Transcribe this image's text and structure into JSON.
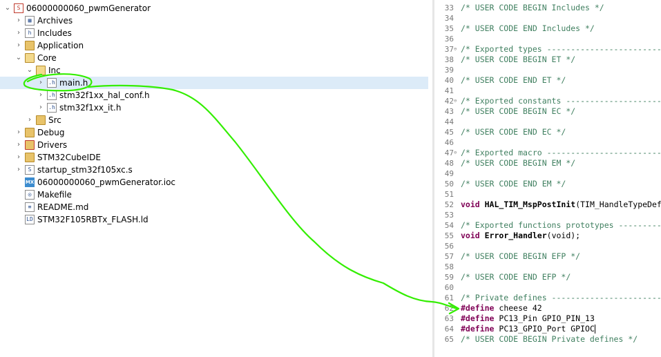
{
  "tree": [
    {
      "label": "06000000060_pwmGenerator",
      "level": 0,
      "arrow": "open",
      "icon": "project-icon"
    },
    {
      "label": "Archives",
      "level": 1,
      "arrow": "closed",
      "icon": "archive-icon"
    },
    {
      "label": "Includes",
      "level": 1,
      "arrow": "closed",
      "icon": "includes-icon"
    },
    {
      "label": "Application",
      "level": 1,
      "arrow": "closed",
      "icon": "folder-icon"
    },
    {
      "label": "Core",
      "level": 1,
      "arrow": "open",
      "icon": "folder-open-icon"
    },
    {
      "label": "Inc",
      "level": 2,
      "arrow": "open",
      "icon": "folder-open-icon"
    },
    {
      "label": "main.h",
      "level": 3,
      "arrow": "closed",
      "icon": "header-file-icon",
      "selected": true
    },
    {
      "label": "stm32f1xx_hal_conf.h",
      "level": 3,
      "arrow": "closed",
      "icon": "header-file-icon"
    },
    {
      "label": "stm32f1xx_it.h",
      "level": 3,
      "arrow": "closed",
      "icon": "header-file-icon"
    },
    {
      "label": "Src",
      "level": 2,
      "arrow": "closed",
      "icon": "folder-icon"
    },
    {
      "label": "Debug",
      "level": 1,
      "arrow": "closed",
      "icon": "folder-icon"
    },
    {
      "label": "Drivers",
      "level": 1,
      "arrow": "closed",
      "icon": "folder-error-icon"
    },
    {
      "label": "STM32CubeIDE",
      "level": 1,
      "arrow": "closed",
      "icon": "folder-icon"
    },
    {
      "label": "startup_stm32f105xc.s",
      "level": 1,
      "arrow": "closed",
      "icon": "asm-file-icon"
    },
    {
      "label": "06000000060_pwmGenerator.ioc",
      "level": 1,
      "arrow": "none",
      "icon": "mx-file-icon"
    },
    {
      "label": "Makefile",
      "level": 1,
      "arrow": "none",
      "icon": "makefile-icon"
    },
    {
      "label": "README.md",
      "level": 1,
      "arrow": "none",
      "icon": "text-file-icon"
    },
    {
      "label": "STM32F105RBTx_FLASH.ld",
      "level": 1,
      "arrow": "none",
      "icon": "linker-file-icon"
    }
  ],
  "editor": {
    "lines": [
      {
        "n": "33",
        "fold": "",
        "parts": [
          {
            "t": "/* USER CODE BEGIN Includes */",
            "c": "cm"
          }
        ]
      },
      {
        "n": "34",
        "fold": "",
        "parts": []
      },
      {
        "n": "35",
        "fold": "",
        "parts": [
          {
            "t": "/* USER CODE END Includes */",
            "c": "cm"
          }
        ]
      },
      {
        "n": "36",
        "fold": "",
        "parts": []
      },
      {
        "n": "37",
        "fold": "⊖",
        "parts": [
          {
            "t": "/* Exported types ------------------------------------------------------------*/",
            "c": "cm"
          }
        ]
      },
      {
        "n": "38",
        "fold": "",
        "parts": [
          {
            "t": "/* USER CODE BEGIN ET */",
            "c": "cm"
          }
        ]
      },
      {
        "n": "39",
        "fold": "",
        "parts": []
      },
      {
        "n": "40",
        "fold": "",
        "parts": [
          {
            "t": "/* USER CODE END ET */",
            "c": "cm"
          }
        ]
      },
      {
        "n": "41",
        "fold": "",
        "parts": []
      },
      {
        "n": "42",
        "fold": "⊖",
        "parts": [
          {
            "t": "/* Exported constants --------------------------------------------------------*/",
            "c": "cm"
          }
        ]
      },
      {
        "n": "43",
        "fold": "",
        "parts": [
          {
            "t": "/* USER CODE BEGIN EC */",
            "c": "cm"
          }
        ]
      },
      {
        "n": "44",
        "fold": "",
        "parts": []
      },
      {
        "n": "45",
        "fold": "",
        "parts": [
          {
            "t": "/* USER CODE END EC */",
            "c": "cm"
          }
        ]
      },
      {
        "n": "46",
        "fold": "",
        "parts": []
      },
      {
        "n": "47",
        "fold": "⊖",
        "parts": [
          {
            "t": "/* Exported macro ------------------------------------------------------------*/",
            "c": "cm"
          }
        ]
      },
      {
        "n": "48",
        "fold": "",
        "parts": [
          {
            "t": "/* USER CODE BEGIN EM */",
            "c": "cm"
          }
        ]
      },
      {
        "n": "49",
        "fold": "",
        "parts": []
      },
      {
        "n": "50",
        "fold": "",
        "parts": [
          {
            "t": "/* USER CODE END EM */",
            "c": "cm"
          }
        ]
      },
      {
        "n": "51",
        "fold": "",
        "parts": []
      },
      {
        "n": "52",
        "fold": "",
        "parts": [
          {
            "t": "void ",
            "c": "kw"
          },
          {
            "t": "HAL_TIM_MspPostInit",
            "c": "fn"
          },
          {
            "t": "(TIM_HandleTypeDef *htim);",
            "c": ""
          }
        ]
      },
      {
        "n": "53",
        "fold": "",
        "parts": []
      },
      {
        "n": "54",
        "fold": "",
        "parts": [
          {
            "t": "/* Exported functions prototypes ---------------------------------------------*/",
            "c": "cm"
          }
        ]
      },
      {
        "n": "55",
        "fold": "",
        "parts": [
          {
            "t": "void ",
            "c": "kw"
          },
          {
            "t": "Error_Handler",
            "c": "fn"
          },
          {
            "t": "(void);",
            "c": ""
          }
        ]
      },
      {
        "n": "56",
        "fold": "",
        "parts": []
      },
      {
        "n": "57",
        "fold": "",
        "parts": [
          {
            "t": "/* USER CODE BEGIN EFP */",
            "c": "cm"
          }
        ]
      },
      {
        "n": "58",
        "fold": "",
        "parts": []
      },
      {
        "n": "59",
        "fold": "",
        "parts": [
          {
            "t": "/* USER CODE END EFP */",
            "c": "cm"
          }
        ]
      },
      {
        "n": "60",
        "fold": "",
        "parts": []
      },
      {
        "n": "61",
        "fold": "",
        "parts": [
          {
            "t": "/* Private defines -----------------------------------------------------------*/",
            "c": "cm"
          }
        ]
      },
      {
        "n": "62",
        "fold": "",
        "parts": [
          {
            "t": "#define",
            "c": "pp"
          },
          {
            "t": " cheese 42",
            "c": ""
          }
        ]
      },
      {
        "n": "63",
        "fold": "",
        "parts": [
          {
            "t": "#define",
            "c": "pp"
          },
          {
            "t": " PC13_Pin GPIO_PIN_13",
            "c": ""
          }
        ]
      },
      {
        "n": "64",
        "fold": "",
        "parts": [
          {
            "t": "#define",
            "c": "pp"
          },
          {
            "t": " PC13_GPIO_Port GPIOC",
            "c": ""
          },
          {
            "t": "",
            "c": "caret"
          }
        ]
      },
      {
        "n": "65",
        "fold": "",
        "parts": [
          {
            "t": "/* USER CODE BEGIN Private defines */",
            "c": "cm"
          }
        ]
      }
    ]
  },
  "colors": {
    "annotation": "#33ee00",
    "comment": "#3f7f5f",
    "keyword": "#7f0055",
    "selection": "#dcebf8"
  }
}
